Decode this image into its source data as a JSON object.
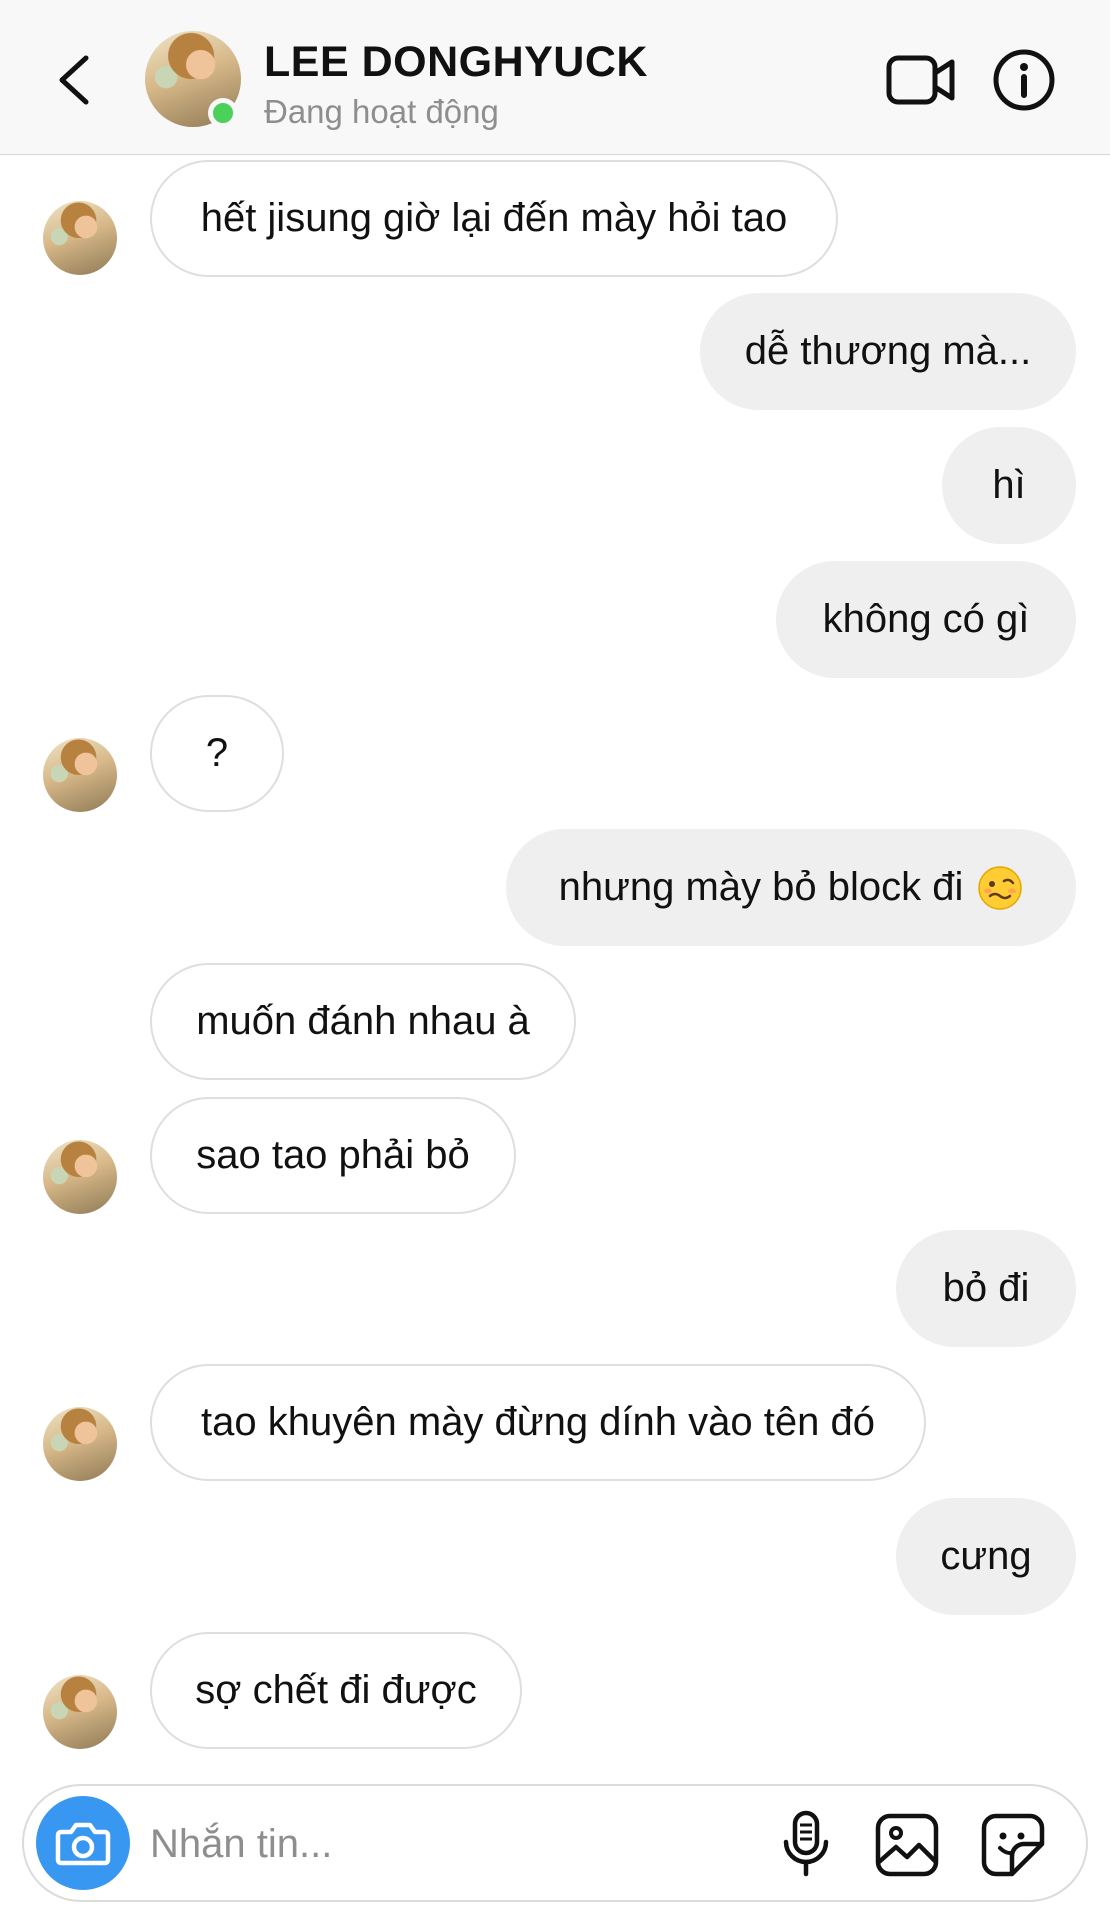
{
  "header": {
    "contact_name": "LEE DONGHYUCK",
    "status": "Đang hoạt động",
    "back_icon": "chevron-left-icon",
    "video_icon": "video-camera-icon",
    "info_icon": "info-icon",
    "online_color": "#4bd059"
  },
  "messages": [
    {
      "side": "in",
      "text": "hết jisung giờ lại đến mày hỏi tao"
    },
    {
      "side": "out",
      "text": "dễ thương mà..."
    },
    {
      "side": "out",
      "text": "hì"
    },
    {
      "side": "out",
      "text": "không có gì"
    },
    {
      "side": "in",
      "text": "?"
    },
    {
      "side": "out",
      "text": "nhưng mày bỏ block đi",
      "emoji": "woozy-face-emoji"
    },
    {
      "side": "in",
      "text": "muốn đánh nhau à"
    },
    {
      "side": "in",
      "text": "sao tao phải bỏ"
    },
    {
      "side": "out",
      "text": "bỏ đi"
    },
    {
      "side": "in",
      "text": "tao khuyên mày đừng dính vào tên đó"
    },
    {
      "side": "out",
      "text": "cưng"
    },
    {
      "side": "in",
      "text": "sợ chết đi được"
    }
  ],
  "composer": {
    "placeholder": "Nhắn tin...",
    "camera_icon": "camera-icon",
    "mic_icon": "microphone-icon",
    "gallery_icon": "gallery-icon",
    "sticker_icon": "sticker-icon",
    "accent_color": "#3897f0"
  }
}
